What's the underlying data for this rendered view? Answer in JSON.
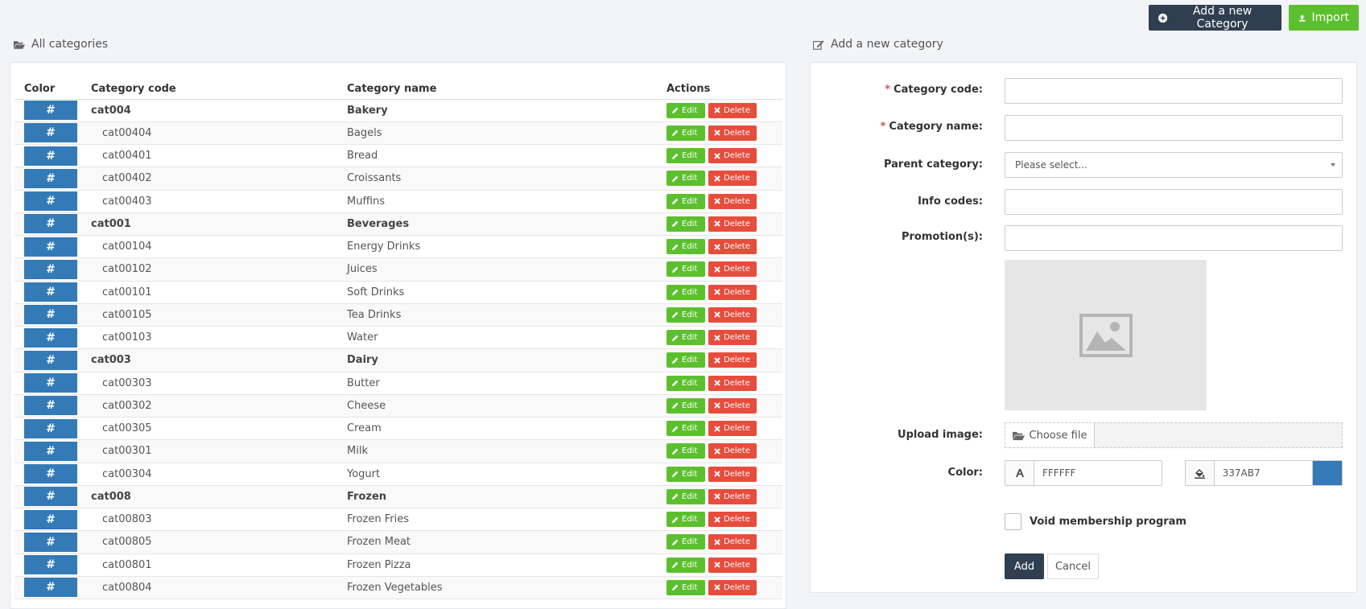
{
  "toolbar": {
    "add_category_label": "Add a new Category",
    "import_label": "Import"
  },
  "list": {
    "title": "All categories",
    "columns": [
      "Color",
      "Category code",
      "Category name",
      "Actions"
    ],
    "edit_label": "Edit",
    "delete_label": "Delete",
    "color_symbol": "#",
    "rows": [
      {
        "code": "cat004",
        "name": "Bakery",
        "parent": true
      },
      {
        "code": "cat00404",
        "name": "Bagels",
        "parent": false
      },
      {
        "code": "cat00401",
        "name": "Bread",
        "parent": false
      },
      {
        "code": "cat00402",
        "name": "Croissants",
        "parent": false
      },
      {
        "code": "cat00403",
        "name": "Muffins",
        "parent": false
      },
      {
        "code": "cat001",
        "name": "Beverages",
        "parent": true
      },
      {
        "code": "cat00104",
        "name": "Energy Drinks",
        "parent": false
      },
      {
        "code": "cat00102",
        "name": "Juices",
        "parent": false
      },
      {
        "code": "cat00101",
        "name": "Soft Drinks",
        "parent": false
      },
      {
        "code": "cat00105",
        "name": "Tea Drinks",
        "parent": false
      },
      {
        "code": "cat00103",
        "name": "Water",
        "parent": false
      },
      {
        "code": "cat003",
        "name": "Dairy",
        "parent": true
      },
      {
        "code": "cat00303",
        "name": "Butter",
        "parent": false
      },
      {
        "code": "cat00302",
        "name": "Cheese",
        "parent": false
      },
      {
        "code": "cat00305",
        "name": "Cream",
        "parent": false
      },
      {
        "code": "cat00301",
        "name": "Milk",
        "parent": false
      },
      {
        "code": "cat00304",
        "name": "Yogurt",
        "parent": false
      },
      {
        "code": "cat008",
        "name": "Frozen",
        "parent": true
      },
      {
        "code": "cat00803",
        "name": "Frozen Fries",
        "parent": false
      },
      {
        "code": "cat00805",
        "name": "Frozen Meat",
        "parent": false
      },
      {
        "code": "cat00801",
        "name": "Frozen Pizza",
        "parent": false
      },
      {
        "code": "cat00804",
        "name": "Frozen Vegetables",
        "parent": false
      }
    ]
  },
  "form": {
    "title": "Add a new category",
    "code_label": "Category code:",
    "name_label": "Category name:",
    "parent_label": "Parent category:",
    "parent_value": "Please select...",
    "info_label": "Info codes:",
    "promo_label": "Promotion(s):",
    "upload_label": "Upload image:",
    "choose_label": "Choose file",
    "color_label": "Color:",
    "text_color": "FFFFFF",
    "bg_color": "337AB7",
    "void_label": "Void membership program",
    "add_label": "Add",
    "cancel_label": "Cancel",
    "required_mark": "*"
  },
  "colors": {
    "primary_dark": "#2f3e50",
    "success": "#5cc02e",
    "danger": "#e74c3c",
    "category_blue": "#337ab7"
  }
}
